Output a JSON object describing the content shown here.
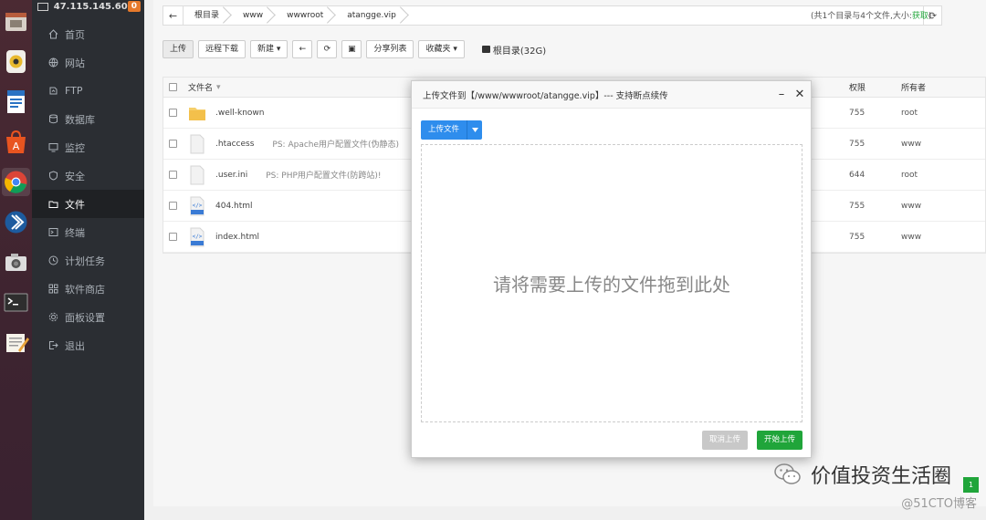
{
  "host": {
    "ip": "47.115.145.60",
    "badge": "0"
  },
  "nav": [
    {
      "label": "首页",
      "icon": "home-icon"
    },
    {
      "label": "网站",
      "icon": "globe-icon"
    },
    {
      "label": "FTP",
      "icon": "ftp-icon"
    },
    {
      "label": "数据库",
      "icon": "database-icon"
    },
    {
      "label": "监控",
      "icon": "monitor-icon"
    },
    {
      "label": "安全",
      "icon": "shield-icon"
    },
    {
      "label": "文件",
      "icon": "folder-icon",
      "active": true
    },
    {
      "label": "终端",
      "icon": "terminal-icon"
    },
    {
      "label": "计划任务",
      "icon": "clock-icon"
    },
    {
      "label": "软件商店",
      "icon": "grid-icon"
    },
    {
      "label": "面板设置",
      "icon": "settings-icon"
    },
    {
      "label": "退出",
      "icon": "logout-icon"
    }
  ],
  "path": {
    "crumbs": [
      "根目录",
      "www",
      "wwwroot",
      "atangge.vip"
    ],
    "summary_prefix": "(共1个目录与4个文件,大小:",
    "summary_link": "获取",
    "summary_suffix": ")"
  },
  "toolbar": {
    "upload": "上传",
    "remote_download": "远程下载",
    "new": "新建",
    "share_list": "分享列表",
    "favorites": "收藏夹",
    "disk": "根目录(32G)"
  },
  "table": {
    "headers": {
      "name": "文件名",
      "perm": "权限",
      "owner": "所有者"
    },
    "rows": [
      {
        "name": ".well-known",
        "note": "",
        "type": "folder",
        "perm": "755",
        "owner": "root"
      },
      {
        "name": ".htaccess",
        "note": "PS: Apache用户配置文件(伪静态)",
        "type": "file",
        "perm": "755",
        "owner": "www"
      },
      {
        "name": ".user.ini",
        "note": "PS: PHP用户配置文件(防跨站)!",
        "type": "file",
        "perm": "644",
        "owner": "root"
      },
      {
        "name": "404.html",
        "note": "",
        "type": "html",
        "perm": "755",
        "owner": "www"
      },
      {
        "name": "index.html",
        "note": "",
        "type": "html",
        "perm": "755",
        "owner": "www"
      }
    ]
  },
  "modal": {
    "title": "上传文件到【/www/wwwroot/atangge.vip】--- 支持断点续传",
    "upload_file": "上传文件",
    "drop_hint": "请将需要上传的文件拖到此处",
    "cancel": "取消上传",
    "start": "开始上传"
  },
  "watermark": {
    "text": "价值投资生活圈",
    "site": "@51CTO博客"
  },
  "fab_label": "1",
  "colors": {
    "primary": "#2e8ded",
    "success": "#20a53a",
    "sidebar": "#2b2e33",
    "dock": "#3e2430"
  }
}
